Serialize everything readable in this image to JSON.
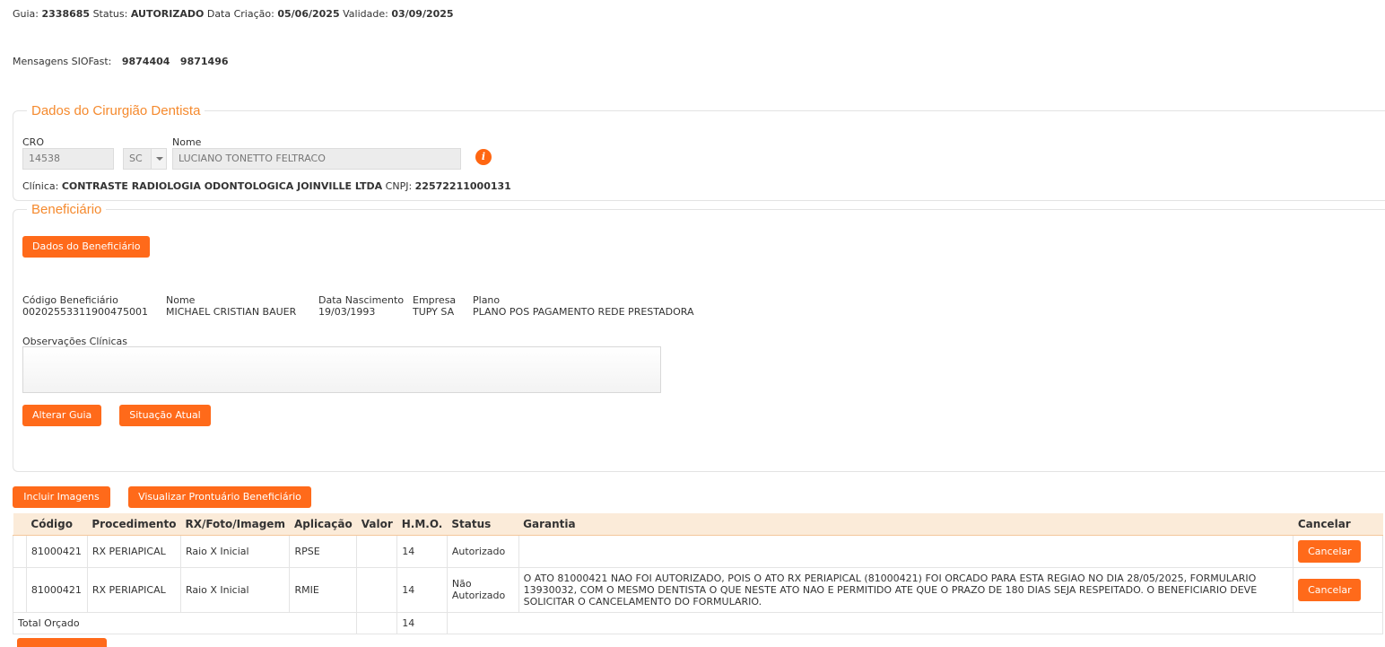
{
  "header": {
    "guia_label": "Guia:",
    "guia_value": "2338685",
    "status_label": "Status:",
    "status_value": "AUTORIZADO",
    "data_criacao_label": "Data Criação:",
    "data_criacao_value": "05/06/2025",
    "validade_label": "Validade:",
    "validade_value": "03/09/2025"
  },
  "siofast": {
    "label": "Mensagens SIOFast:",
    "messages": [
      "9874404",
      "9871496"
    ]
  },
  "dentista": {
    "legend": "Dados do Cirurgião Dentista",
    "cro_label": "CRO",
    "cro_value": "14538",
    "uf_value": "SC",
    "nome_label": "Nome",
    "nome_value": "LUCIANO TONETTO FELTRACO",
    "info_icon": "info-icon",
    "clinica_label": "Clínica:",
    "clinica_value": "CONTRASTE RADIOLOGIA ODONTOLOGICA JOINVILLE LTDA",
    "cnpj_label": "CNPJ:",
    "cnpj_value": "22572211000131"
  },
  "beneficiario": {
    "legend": "Beneficiário",
    "dados_button": "Dados do Beneficiário",
    "codigo_label": "Código Beneficiário",
    "codigo_value": "00202553311900475001",
    "nome_label": "Nome",
    "nome_value": "MICHAEL CRISTIAN BAUER",
    "nascimento_label": "Data Nascimento",
    "nascimento_value": "19/03/1993",
    "empresa_label": "Empresa",
    "empresa_value": "TUPY SA",
    "plano_label": "Plano",
    "plano_value": "PLANO POS PAGAMENTO REDE PRESTADORA",
    "obs_label": "Observações Clínicas",
    "obs_value": "",
    "alterar_button": "Alterar Guia",
    "situacao_button": "Situação Atual"
  },
  "actions": {
    "incluir_imagens": "Incluir Imagens",
    "visualizar_prontuario": "Visualizar Prontuário Beneficiário"
  },
  "table": {
    "headers": [
      "Código",
      "Procedimento",
      "RX/Foto/Imagem",
      "Aplicação",
      "Valor",
      "H.M.O.",
      "Status",
      "Garantia",
      "Cancelar"
    ],
    "rows": [
      {
        "codigo": "81000421",
        "procedimento": "RX PERIAPICAL",
        "rx": "Raio X Inicial",
        "aplicacao": "RPSE",
        "valor": "",
        "hmo": "14",
        "status": "Autorizado",
        "garantia": "",
        "cancel_label": "Cancelar"
      },
      {
        "codigo": "81000421",
        "procedimento": "RX PERIAPICAL",
        "rx": "Raio X Inicial",
        "aplicacao": "RMIE",
        "valor": "",
        "hmo": "14",
        "status": "Não Autorizado",
        "garantia": "O ATO 81000421 NAO FOI AUTORIZADO, POIS O ATO RX PERIAPICAL (81000421) FOI ORCADO PARA ESTA REGIAO NO DIA 28/05/2025, FORMULARIO 13930032, COM O MESMO DENTISTA O QUE NESTE ATO NAO E PERMITIDO ATE QUE O PRAZO DE 180 DIAS SEJA RESPEITADO. O BENEFICIARIO DEVE SOLICITAR O CANCELAMENTO DO FORMULARIO.",
        "cancel_label": "Cancelar"
      }
    ],
    "total_label": "Total Orçado",
    "total_hmo": "14"
  },
  "colors": {
    "accent": "#ff6a1a",
    "legend": "#f58a2e",
    "table_header_bg": "#fbebd9"
  }
}
